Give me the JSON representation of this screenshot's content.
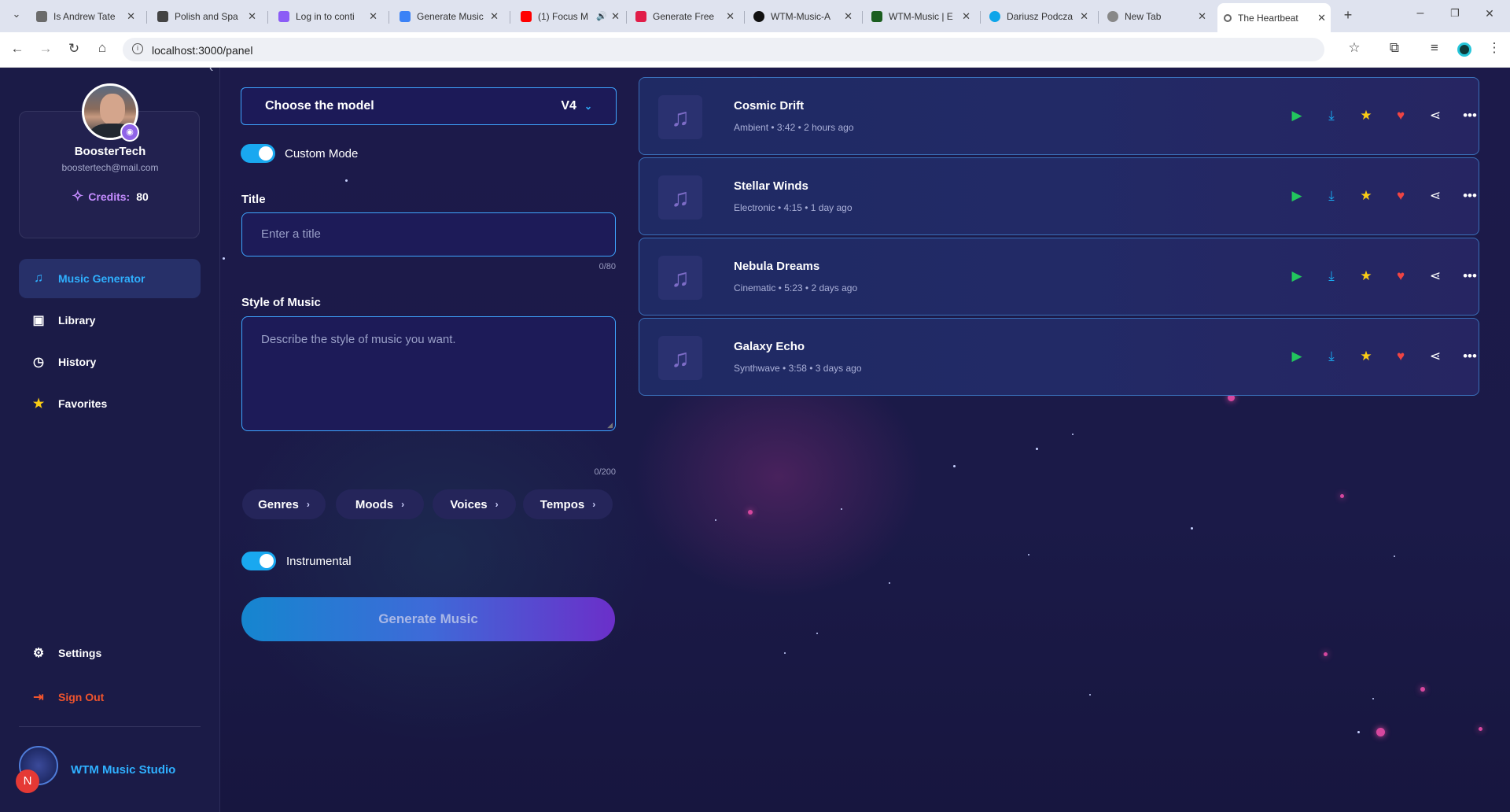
{
  "browser": {
    "tabs": [
      {
        "title": "Is Andrew Tate",
        "color": "#6b6b6b"
      },
      {
        "title": "Polish and Spa",
        "color": "#444444"
      },
      {
        "title": "Log in to conti",
        "color": "#8b5cf6"
      },
      {
        "title": "Generate Music",
        "color": "#3b82f6"
      },
      {
        "title": "(1) Focus M",
        "color": "#ff0000"
      },
      {
        "title": "Generate Free",
        "color": "#e11d48"
      },
      {
        "title": "WTM-Music-A",
        "color": "#111111"
      },
      {
        "title": "WTM-Music | E",
        "color": "#1b5e20"
      },
      {
        "title": "Dariusz Podcza",
        "color": "#0ea5e9"
      },
      {
        "title": "New Tab",
        "color": "#888888"
      },
      {
        "title": "The Heartbeat",
        "color": "#666666"
      }
    ],
    "url": "localhost:3000/panel"
  },
  "profile": {
    "name": "BoosterTech",
    "email": "boostertech@mail.com",
    "credits_label": "Credits:",
    "credits_value": "80"
  },
  "nav": {
    "items": [
      {
        "label": "Music Generator",
        "icon": "music-notes-icon"
      },
      {
        "label": "Library",
        "icon": "library-icon"
      },
      {
        "label": "History",
        "icon": "history-icon"
      },
      {
        "label": "Favorites",
        "icon": "star-icon"
      }
    ],
    "settings": "Settings",
    "signout": "Sign Out",
    "brand": "WTM Music Studio",
    "badge": "N"
  },
  "form": {
    "model_label": "Choose the model",
    "model_value": "V4",
    "custom_mode": "Custom Mode",
    "title_label": "Title",
    "title_placeholder": "Enter a title",
    "title_counter": "0/80",
    "style_label": "Style of Music",
    "style_placeholder": "Describe the style of music you want.",
    "style_counter": "0/200",
    "chips": [
      "Genres",
      "Moods",
      "Voices",
      "Tempos"
    ],
    "instrumental": "Instrumental",
    "generate": "Generate Music"
  },
  "tracks": [
    {
      "title": "Cosmic Drift",
      "meta": "Ambient • 3:42 • 2 hours ago"
    },
    {
      "title": "Stellar Winds",
      "meta": "Electronic • 4:15 • 1 day ago"
    },
    {
      "title": "Nebula Dreams",
      "meta": "Cinematic • 5:23 • 2 days ago"
    },
    {
      "title": "Galaxy Echo",
      "meta": "Synthwave • 3:58 • 3 days ago"
    }
  ],
  "colors": {
    "accent": "#19a8f0",
    "play": "#22c55e",
    "download": "#19a8f0",
    "star": "#facc15",
    "heart": "#ef4444",
    "signout": "#f0542d",
    "credits": "#c48cff"
  }
}
